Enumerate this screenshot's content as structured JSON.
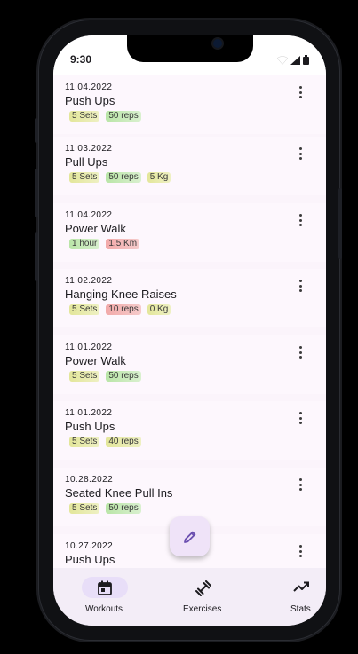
{
  "status_bar": {
    "time": "9:30",
    "icons": [
      "wifi-icon",
      "signal-icon",
      "battery-icon"
    ]
  },
  "workouts": [
    {
      "date": "11.04.2022",
      "title": "Push Ups",
      "chips": [
        {
          "text": "5 Sets",
          "tone": "yellow"
        },
        {
          "text": "50 reps",
          "tone": "green"
        }
      ]
    },
    {
      "date": "11.03.2022",
      "title": "Pull Ups",
      "chips": [
        {
          "text": "5 Sets",
          "tone": "yellow"
        },
        {
          "text": "50 reps",
          "tone": "green"
        },
        {
          "text": "5 Kg",
          "tone": "yellow"
        }
      ]
    },
    {
      "date": "11.04.2022",
      "title": "Power Walk",
      "chips": [
        {
          "text": "1 hour",
          "tone": "green"
        },
        {
          "text": "1.5 Km",
          "tone": "red"
        }
      ]
    },
    {
      "date": "11.02.2022",
      "title": "Hanging Knee Raises",
      "chips": [
        {
          "text": "5 Sets",
          "tone": "yellow"
        },
        {
          "text": "10 reps",
          "tone": "red"
        },
        {
          "text": "0 Kg",
          "tone": "yellow"
        }
      ]
    },
    {
      "date": "11.01.2022",
      "title": "Power Walk",
      "chips": [
        {
          "text": "5 Sets",
          "tone": "yellow"
        },
        {
          "text": "50 reps",
          "tone": "green"
        }
      ]
    },
    {
      "date": "11.01.2022",
      "title": "Push Ups",
      "chips": [
        {
          "text": "5 Sets",
          "tone": "yellow"
        },
        {
          "text": "40 reps",
          "tone": "yellow"
        }
      ]
    },
    {
      "date": "10.28.2022",
      "title": "Seated Knee Pull Ins",
      "chips": [
        {
          "text": "5 Sets",
          "tone": "yellow"
        },
        {
          "text": "50 reps",
          "tone": "green"
        }
      ]
    },
    {
      "date": "10.27.2022",
      "title": "Push Ups",
      "chips": []
    }
  ],
  "fab": {
    "icon": "pencil-icon"
  },
  "bottom_nav": {
    "items": [
      {
        "label": "Workouts",
        "icon": "calendar-icon",
        "active": true
      },
      {
        "label": "Exercises",
        "icon": "dumbbell-icon",
        "active": false
      },
      {
        "label": "Stats",
        "icon": "trending-up-icon",
        "active": false
      }
    ]
  },
  "colors": {
    "accent": "#e8def8",
    "nav_background": "#f3edf7",
    "card_background": "#fdf7fd",
    "fab_icon": "#6b4fb0"
  }
}
